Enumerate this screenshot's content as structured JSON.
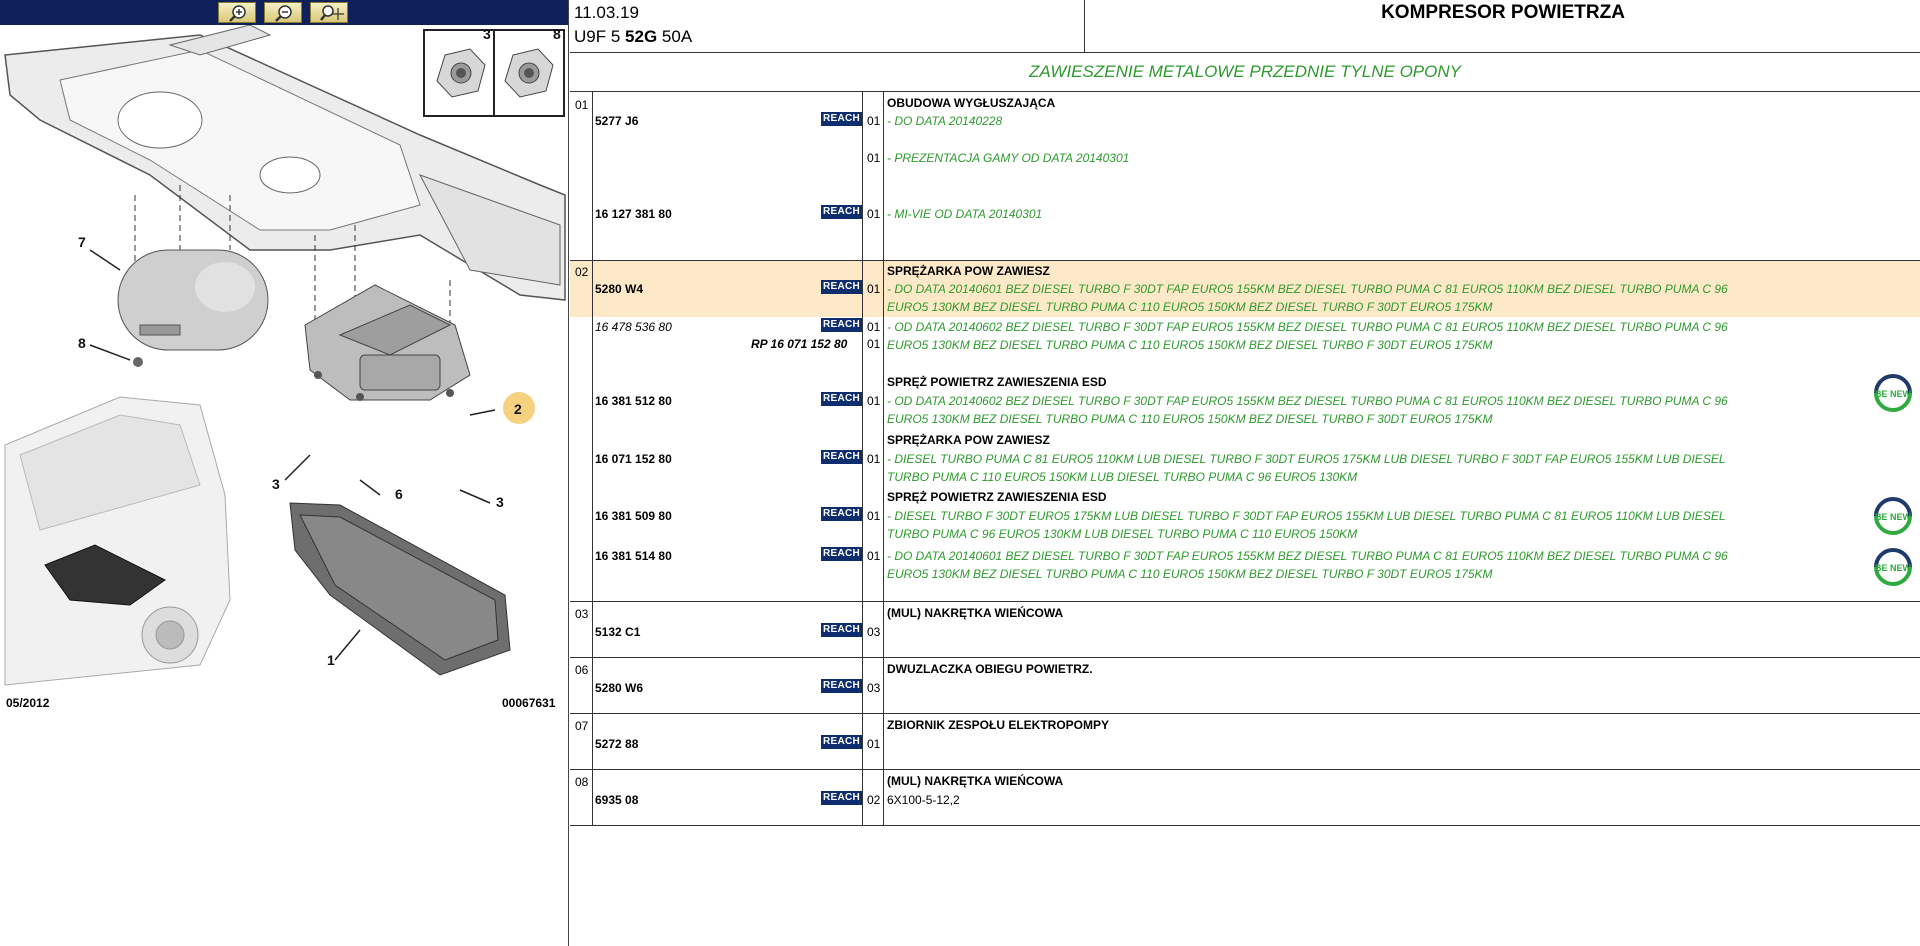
{
  "toolbar": {
    "zoom_in": "zoom-in-icon",
    "zoom_out": "zoom-out-icon",
    "pan": "pan-icon"
  },
  "diagram": {
    "callouts": [
      "3",
      "8",
      "7",
      "8",
      "2",
      "3",
      "6",
      "3",
      "1"
    ],
    "footer_date": "05/2012",
    "footer_code": "00067631"
  },
  "header": {
    "date": "11.03.19",
    "model_a": "U9F 5",
    "model_b": "52G",
    "model_c": "50A",
    "title": "KOMPRESOR POWIETRZA"
  },
  "group_title": "ZAWIESZENIE METALOWE PRZEDNIE TYLNE OPONY",
  "reach_label": "REACH",
  "sections": [
    {
      "ref": "01",
      "parts": [
        {
          "pn": "5277 J6",
          "qty": "01",
          "name": "OBUDOWA WYGŁUSZAJĄCA",
          "note": "- DO DATA 20140228"
        },
        {
          "qty": "01",
          "note": "- PREZENTACJA GAMY OD DATA 20140301"
        },
        {
          "pn": "16 127 381 80",
          "qty": "01",
          "note": "- MI-VIE OD DATA 20140301"
        }
      ]
    },
    {
      "ref": "02",
      "parts": [
        {
          "pn": "5280 W4",
          "qty": "01",
          "name": "SPRĘŻARKA POW ZAWIESZ",
          "note": "- DO DATA 20140601 BEZ DIESEL TURBO F 30DT FAP EURO5 155KM BEZ DIESEL TURBO PUMA C 81 EURO5 110KM BEZ DIESEL TURBO PUMA C 96 EURO5 130KM BEZ DIESEL TURBO PUMA C 110 EURO5 150KM BEZ DIESEL TURBO F 30DT EURO5 175KM"
        },
        {
          "pn": "16 478 536 80",
          "rp": "RP 16 071 152 80",
          "qty": "01",
          "qty2": "01",
          "note": "- OD DATA 20140602 BEZ DIESEL TURBO F 30DT FAP EURO5 155KM BEZ DIESEL TURBO PUMA C 81 EURO5 110KM BEZ DIESEL TURBO PUMA C 96 EURO5 130KM BEZ DIESEL TURBO PUMA C 110 EURO5 150KM BEZ DIESEL TURBO F 30DT EURO5 175KM"
        },
        {
          "pn": "16 381 512 80",
          "qty": "01",
          "name": "SPRĘŻ POWIETRZ ZAWIESZENIA ESD",
          "note": "- OD DATA 20140602 BEZ DIESEL TURBO F 30DT FAP EURO5 155KM BEZ DIESEL TURBO PUMA C 81 EURO5 110KM BEZ DIESEL TURBO PUMA C 96 EURO5 130KM BEZ DIESEL TURBO PUMA C 110 EURO5 150KM BEZ DIESEL TURBO F 30DT EURO5 175KM"
        },
        {
          "pn": "16 071 152 80",
          "qty": "01",
          "name": "SPRĘŻARKA POW ZAWIESZ",
          "note": "- DIESEL TURBO PUMA C 81 EURO5 110KM LUB DIESEL TURBO F 30DT EURO5 175KM LUB DIESEL TURBO F 30DT FAP EURO5 155KM LUB DIESEL TURBO PUMA C 110 EURO5 150KM LUB DIESEL TURBO PUMA C 96 EURO5 130KM"
        },
        {
          "pn": "16 381 509 80",
          "qty": "01",
          "name": "SPRĘŻ POWIETRZ ZAWIESZENIA ESD",
          "note": "- DIESEL TURBO F 30DT EURO5 175KM LUB DIESEL TURBO F 30DT FAP EURO5 155KM LUB DIESEL TURBO PUMA C 81 EURO5 110KM LUB DIESEL TURBO PUMA C 96 EURO5 130KM LUB DIESEL TURBO PUMA C 110 EURO5 150KM"
        },
        {
          "pn": "16 381 514 80",
          "qty": "01",
          "note": "- DO DATA 20140601 BEZ DIESEL TURBO F 30DT FAP EURO5 155KM BEZ DIESEL TURBO PUMA C 81 EURO5 110KM BEZ DIESEL TURBO PUMA C 96 EURO5 130KM BEZ DIESEL TURBO PUMA C 110 EURO5 150KM BEZ DIESEL TURBO F 30DT EURO5 175KM"
        }
      ],
      "badge_text": "BE NEW"
    },
    {
      "ref": "03",
      "parts": [
        {
          "pn": "5132 C1",
          "qty": "03",
          "name": "(MUL) NAKRĘTKA WIEŃCOWA"
        }
      ]
    },
    {
      "ref": "06",
      "parts": [
        {
          "pn": "5280 W6",
          "qty": "03",
          "name": "DWUZLACZKA OBIEGU POWIETRZ."
        }
      ]
    },
    {
      "ref": "07",
      "parts": [
        {
          "pn": "5272 88",
          "qty": "01",
          "name": "ZBIORNIK ZESPOŁU ELEKTROPOMPY"
        }
      ]
    },
    {
      "ref": "08",
      "parts": [
        {
          "pn": "6935 08",
          "qty": "02",
          "name": "(MUL) NAKRĘTKA WIEŃCOWA",
          "plain": "6X100-5-12,2"
        }
      ]
    }
  ],
  "colors": {
    "note_green": "#2e9a2e",
    "reach_blue": "#0d2d6e",
    "highlight": "#fde9c7",
    "toolbar": "#10205a"
  }
}
